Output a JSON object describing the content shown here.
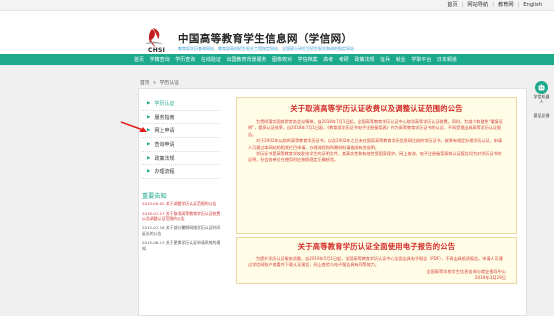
{
  "top_links": [
    "首页",
    "网站导航",
    "教育网",
    "English"
  ],
  "header": {
    "title": "中国高等教育学生信息网（学信网）",
    "logo_text": "CHSI",
    "slogan": "教育部学历查询网站、教育部高校招生阳光工程指定网站、全国硕士研究生招生报名和调剂指定网站"
  },
  "nav": [
    "首页",
    "学籍查询",
    "学历查询",
    "在线验证",
    "出国教育背景服务",
    "图像校对",
    "学信档案",
    "高考",
    "考研",
    "政策法规",
    "征兵",
    "就业",
    "学职平台",
    "日本频道"
  ],
  "breadcrumb": [
    "首页",
    "»",
    "学历认证"
  ],
  "side_menu": [
    {
      "label": "学历认证",
      "active": true
    },
    {
      "label": "服务指南",
      "active": false
    },
    {
      "label": "网上申请",
      "active": false
    },
    {
      "label": "查询申请",
      "active": false
    },
    {
      "label": "政策法规",
      "active": false
    },
    {
      "label": "办理流程",
      "active": false
    }
  ],
  "notice": {
    "title": "重要告知",
    "items": [
      {
        "text": "2019-09-02 关于调整学历认证范围的公告",
        "red": true
      },
      {
        "text": "2018-07-27 关于取消高等教育学历认证收费以及调整认证范围的公告",
        "red": true
      },
      {
        "text": "2015-07-16 关于部分暑期网络学历认证时间延长的公告",
        "red": false
      },
      {
        "text": "2015-08-13 关于更换学历认证申请系统的通知",
        "red": false
      }
    ]
  },
  "box1": {
    "title": "关于取消高等学历认证收费以及调整认证范围的公告",
    "paragraphs": [
      "为贯彻落实国务院常务会议精神，自2018年7月1日起，全国高等教育学历认证中心取消高等学历认证收费。同时，为减少和避免“重复证明”，提高认证效率，自2018年7月1日起，《教育部学历证书电子注册备案表》作为高等教育学历证书的认证，不再受理出具高等学历认证报告。",
      "对于2002年以前的高等教育学历证书，以及2002年之后未在国家高等教育学历信息网注册的学历证书，按原有规定办理学历认证，申请人可通过本网站的相关栏目申请，办理流程和所需材料请查阅有关说明。",
      "学历证书是高等教育学校发给学生的证明文件，其真实性和有效性受国家保护。网上查询、电子注册备案表和认证报告均为对学历证书的证明，社会各单位在使用时应按照规定正确核验。"
    ]
  },
  "box2": {
    "title": "关于高等教育学历认证全面使用电子报告的公告",
    "paragraphs": [
      "为提升学历认证服务质量，自2019年5月1日起，全国高等教育学历认证中心全面出具电子报告（PDF），不再出具纸质报告。申请人可通过学信网账户查看并下载认证报告，网上查验与电子报告具有同等效力。"
    ],
    "sign_org": "全国高等学校学生信息咨询与就业指导中心",
    "sign_date": "2019年3月29日"
  },
  "float": {
    "robot_label": "学信机器人",
    "feedback_label": "意见反馈"
  },
  "colors": {
    "brand_green": "#1da98c",
    "notice_red": "#d12a2a",
    "notice_bg": "#fffde5"
  }
}
